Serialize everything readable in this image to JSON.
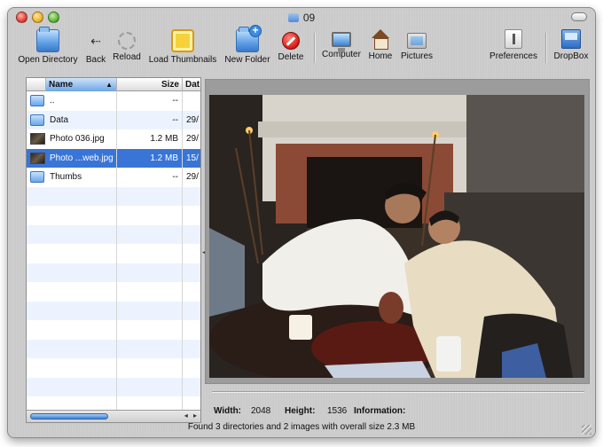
{
  "window": {
    "title": "09"
  },
  "toolbar": {
    "open_directory": "Open Directory",
    "back": "Back",
    "reload": "Reload",
    "load_thumbnails": "Load Thumbnails",
    "new_folder": "New Folder",
    "delete": "Delete",
    "computer": "Computer",
    "home": "Home",
    "pictures": "Pictures",
    "preferences": "Preferences",
    "dropbox": "DropBox"
  },
  "file_list": {
    "columns": {
      "name": "Name",
      "size": "Size",
      "date": "Dat"
    },
    "sort_indicator": "▲",
    "rows": [
      {
        "name": "..",
        "size": "--",
        "date": "",
        "kind": "folder",
        "selected": false
      },
      {
        "name": "Data",
        "size": "--",
        "date": "29/",
        "kind": "folder",
        "selected": false
      },
      {
        "name": "Photo 036.jpg",
        "size": "1.2 MB",
        "date": "29/",
        "kind": "image",
        "selected": false
      },
      {
        "name": "Photo ...web.jpg",
        "size": "1.2 MB",
        "date": "15/",
        "kind": "image",
        "selected": true
      },
      {
        "name": "Thumbs",
        "size": "--",
        "date": "29/",
        "kind": "folder",
        "selected": false
      }
    ],
    "scroll_arrows": "◂ ▸"
  },
  "info": {
    "width_label": "Width:",
    "width_value": "2048",
    "height_label": "Height:",
    "height_value": "1536",
    "information_label": "Information:",
    "information_value": ""
  },
  "status": "Found 3 directories and 2 images with overall size 2.3 MB",
  "colors": {
    "selection": "#3875d7",
    "stripe": "#edf3fe"
  }
}
